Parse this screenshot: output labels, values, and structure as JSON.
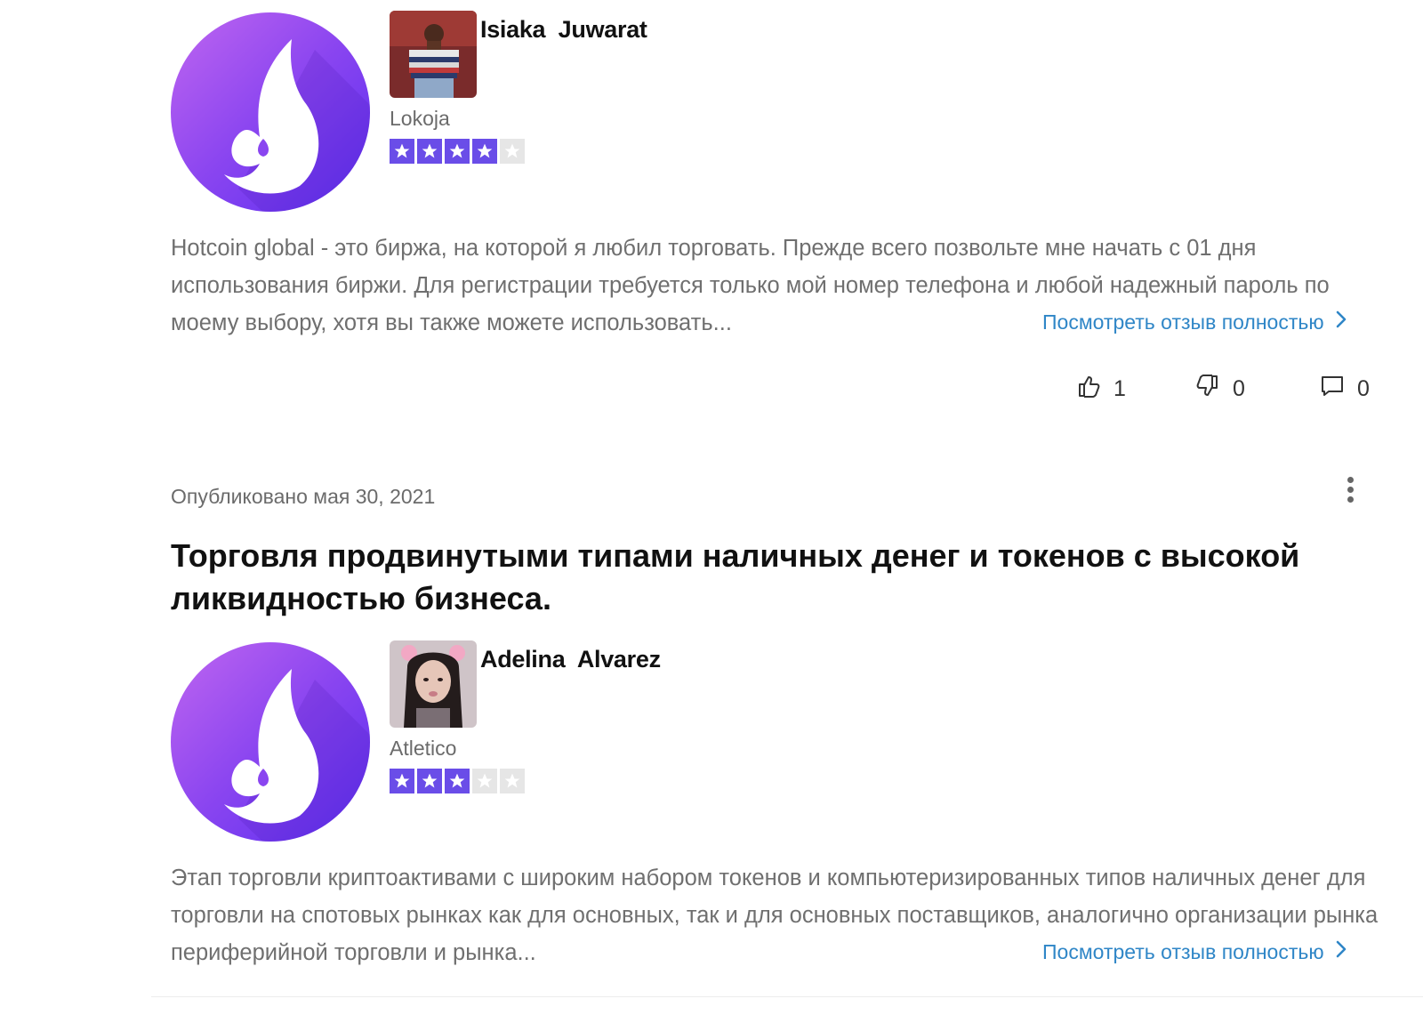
{
  "reviews": [
    {
      "reviewer_name": "Isiaka  Juwarat",
      "location": "Lokoja",
      "rating": 4,
      "rating_max": 5,
      "text": "Hotcoin global - это биржа, на которой я любил торговать. Прежде всего позвольте мне начать с 01 дня использования биржи. Для регистрации требуется только мой номер телефона и любой надежный пароль по моему выбору, хотя вы также можете использовать...",
      "read_more_label": "Посмотреть отзыв полностью",
      "likes": "1",
      "dislikes": "0",
      "comments": "0"
    },
    {
      "published": "Опубликовано мая 30, 2021",
      "title": "Торговля продвинутыми типами наличных денег и токенов с высокой ликвидностью бизнеса.",
      "reviewer_name": "Adelina  Alvarez",
      "location": "Atletico",
      "rating": 3,
      "rating_max": 5,
      "text": "Этап торговли криптоактивами с широким набором токенов и компьютеризированных типов наличных денег для торговли на спотовых рынках как для основных, так и для основных поставщиков, аналогично организации рынка периферийной торговли и рынка...",
      "read_more_label": "Посмотреть отзыв полностью"
    }
  ],
  "icons": {
    "logo": "hotcoin-flame-icon",
    "like": "thumbs-up-icon",
    "dislike": "thumbs-down-icon",
    "comment": "comment-icon",
    "more": "more-vertical-icon",
    "chevron": "chevron-right-icon"
  },
  "colors": {
    "star_on": "#6a4de8",
    "star_off": "#e6e6e6",
    "link": "#2f86c7",
    "logo_gradient": [
      "#c066f0",
      "#5b2ef0"
    ]
  }
}
